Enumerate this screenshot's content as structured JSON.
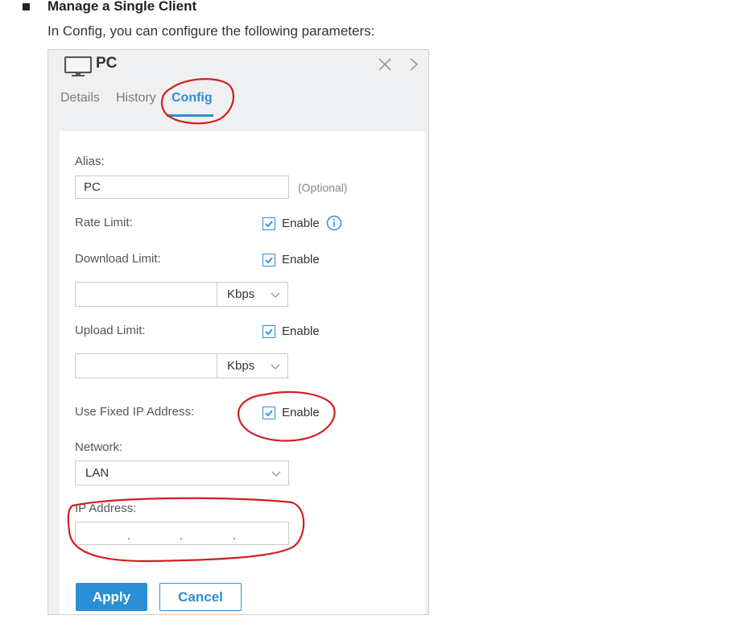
{
  "doc": {
    "heading": "Manage a Single Client",
    "intro": "In Config, you can configure the following parameters:"
  },
  "panel": {
    "title": "PC",
    "tabs": [
      {
        "label": "Details"
      },
      {
        "label": "History"
      },
      {
        "label": "Config"
      }
    ],
    "active_tab": "Config",
    "form": {
      "alias_label": "Alias:",
      "alias_value": "PC",
      "alias_hint": "(Optional)",
      "rate_limit_label": "Rate Limit:",
      "rate_limit_enable": "Enable",
      "download_limit_label": "Download Limit:",
      "download_limit_enable": "Enable",
      "download_value": "",
      "download_unit": "Kbps",
      "upload_limit_label": "Upload Limit:",
      "upload_limit_enable": "Enable",
      "upload_value": "",
      "upload_unit": "Kbps",
      "fixed_ip_label": "Use Fixed IP Address:",
      "fixed_ip_enable": "Enable",
      "network_label": "Network:",
      "network_value": "LAN",
      "ip_label": "IP Address:",
      "ip_dot": "."
    },
    "buttons": {
      "apply": "Apply",
      "cancel": "Cancel"
    }
  },
  "colors": {
    "accent": "#2a8fd6",
    "annotation": "#d01f1f",
    "header_bg": "#eff0f1"
  },
  "icons": {
    "device": "monitor-icon",
    "close": "close-icon",
    "next": "chevron-right-icon",
    "info": "info-icon",
    "dropdown": "chevron-down-icon",
    "check": "checkmark-icon"
  }
}
